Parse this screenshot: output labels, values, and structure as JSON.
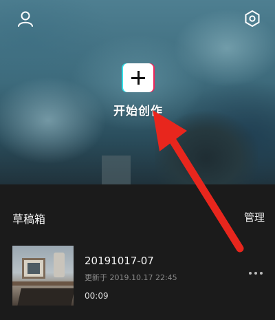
{
  "header": {
    "profile_icon": "user-icon",
    "settings_icon": "gear-icon"
  },
  "create": {
    "icon": "plus-icon",
    "label": "开始创作"
  },
  "drafts": {
    "title": "草稿箱",
    "manage_label": "管理",
    "items": [
      {
        "name": "20191017-07",
        "updated": "更新于 2019.10.17 22:45",
        "duration": "00:09",
        "more_icon": "more-dots-icon"
      }
    ]
  },
  "annotation": {
    "type": "arrow",
    "color": "#e8261d"
  },
  "colors": {
    "panel_background": "#1b1b1b",
    "accent_cyan": "#31e0e8",
    "accent_red": "#f0245a"
  }
}
